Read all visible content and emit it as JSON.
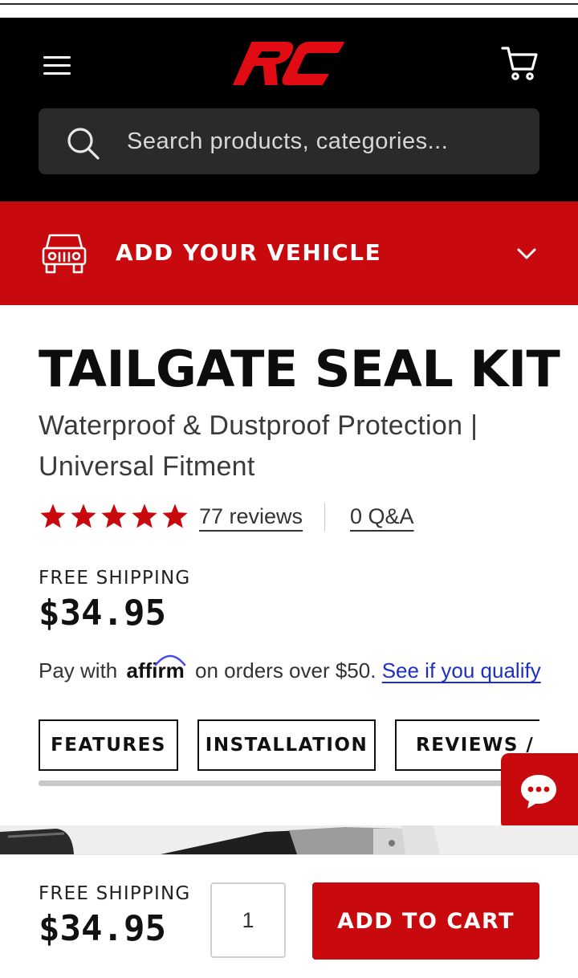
{
  "header": {
    "logo_text": "RC",
    "search": {
      "placeholder": "Search products, categories..."
    }
  },
  "vehicle_bar": {
    "label": "ADD YOUR VEHICLE"
  },
  "product": {
    "title": "TAILGATE SEAL KIT",
    "subtitle": "Waterproof & Dustproof Protection | Universal Fitment",
    "rating": {
      "stars": 5,
      "out_of": 5,
      "reviews_label": "77 reviews",
      "qa_label": "0 Q&A"
    },
    "shipping_label": "FREE SHIPPING",
    "price": "$34.95"
  },
  "affirm": {
    "prefix": "Pay with",
    "brand": "affirm",
    "middle": "on orders over $50.",
    "link": "See if you qualify"
  },
  "tabs": [
    {
      "label": "FEATURES"
    },
    {
      "label": "INSTALLATION"
    },
    {
      "label": "REVIEWS / Q"
    }
  ],
  "sticky_bar": {
    "shipping_label": "FREE SHIPPING",
    "price": "$34.95",
    "quantity": "1",
    "add_to_cart_label": "ADD TO CART"
  },
  "colors": {
    "brand_red": "#c8090d",
    "header_black": "#000000",
    "link_blue": "#1d2fc7"
  }
}
